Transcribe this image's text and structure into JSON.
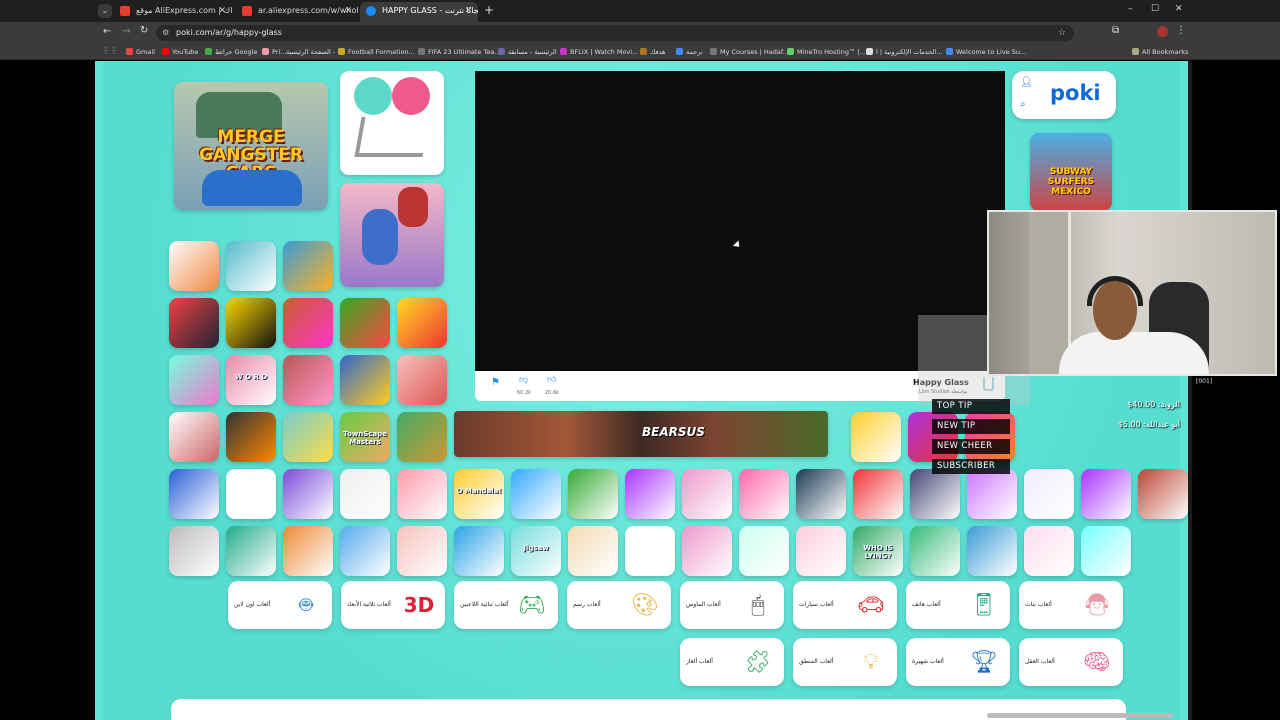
{
  "browser": {
    "tabs": [
      {
        "title": "موقع AliExpress.com | علي اك",
        "active": false
      },
      {
        "title": "ar.aliexpress.com/w/wholesale-",
        "active": false
      },
      {
        "title": "HAPPY GLASS - مجانًا نترنت",
        "active": true
      }
    ],
    "new_tab": "+",
    "url": "poki.com/ar/g/happy-glass",
    "bookmarks": [
      "Gmail",
      "YouTube",
      "خرائط Google",
      "Pri...",
      "الصفحة الرئيسية -",
      "Football Formation...",
      "FIFA 23 Ultimate Tea...",
      "الرئيسية - مسابقة",
      "BFLIX | Watch Movi...",
      "هدفك",
      "ترجمة",
      "My Courses | Hadaf...",
      "MineTro Hosting™ |...",
      "الخدمات الإلكترونية | ا...",
      "Welcome to Live Su..."
    ],
    "all_bookmarks": "All Bookmarks",
    "window_controls": [
      "–",
      "☐",
      "✕"
    ]
  },
  "poki": {
    "logo": "poki",
    "featured_left": "MERGE GANGSTER CARS",
    "side_game": "SUBWAY SURFERS MEXICO",
    "banner_game": "BEARSUS",
    "game": {
      "title": "Happy Glass",
      "developer": "Lion Studios بواسطة",
      "stats": [
        "60.2k",
        "20.6k"
      ]
    },
    "tile_labels": {
      "word": "W O R D",
      "jigsaw": "Jigsaw",
      "mandala": "O Mandala!",
      "who_lying": "WHO IS LYING?",
      "townscape": "TownScape Masters"
    },
    "categories_row1": [
      "ألعاب اون لاين",
      "ألعاب ثلاثية الأبعاد",
      "ألعاب ثنائية اللاعبين",
      "ألعاب رسم",
      "ألعاب الماوس",
      "ألعاب سيارات",
      "ألعاب هاتف",
      "ألعاب بنات"
    ],
    "categories_row2": [
      "ألعاب ألغاز",
      "ألعاب المنطق",
      "ألعاب شهيرة",
      "ألعاب العقل"
    ]
  },
  "stream_overlay": {
    "labels": [
      "TOP TIP",
      "NEW TIP",
      "NEW CHEER",
      "SUBSCRIBER"
    ],
    "values": [
      "الزوبة: 40.00$",
      "أبو عبدالله: 5.00$"
    ],
    "counter": "[001]"
  },
  "colors": {
    "page_bg": "#5fe4d6",
    "browser_bg": "#3b3b3b",
    "poki_blue": "#0a6bd6"
  }
}
